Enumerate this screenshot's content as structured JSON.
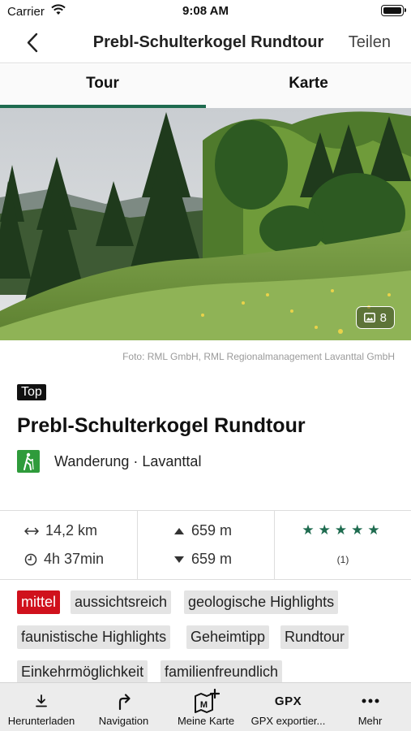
{
  "status_bar": {
    "carrier": "Carrier",
    "time": "9:08 AM"
  },
  "nav": {
    "title": "Prebl-Schulterkogel Rundtour",
    "share_label": "Teilen"
  },
  "tabs": [
    {
      "label": "Tour",
      "active": true
    },
    {
      "label": "Karte",
      "active": false
    }
  ],
  "hero": {
    "photo_count": "8",
    "credit": "Foto: RML GmbH, RML Regionalmanagement Lavanttal GmbH"
  },
  "tour": {
    "badge": "Top",
    "title": "Prebl-Schulterkogel Rundtour",
    "category": "Wanderung · Lavanttal",
    "category_icon": "hiking-icon",
    "category_color": "#2f9b3b"
  },
  "stats": {
    "distance": "14,2 km",
    "duration": "4h 37min",
    "ascent": "659 m",
    "descent": "659 m",
    "stars": "★★★★★",
    "rating_count": "(1)"
  },
  "tags": [
    "mittel",
    "aussichtsreich",
    "geologische Highlights",
    "faunistische Highlights",
    "Geheimtipp",
    "Rundtour",
    "Einkehrmöglichkeit",
    "familienfreundlich"
  ],
  "bottom_bar": [
    {
      "label": "Herunterladen",
      "icon": "download-icon"
    },
    {
      "label": "Navigation",
      "icon": "turn-right-icon"
    },
    {
      "label": "Meine Karte",
      "icon": "add-map-icon"
    },
    {
      "label": "GPX exportier...",
      "icon": "gpx-icon",
      "icon_text": "GPX"
    },
    {
      "label": "Mehr",
      "icon": "more-icon"
    }
  ],
  "colors": {
    "accent": "#1e6b4f",
    "tag_difficulty": "#d0111c",
    "tag_bg": "#e4e4e4"
  }
}
